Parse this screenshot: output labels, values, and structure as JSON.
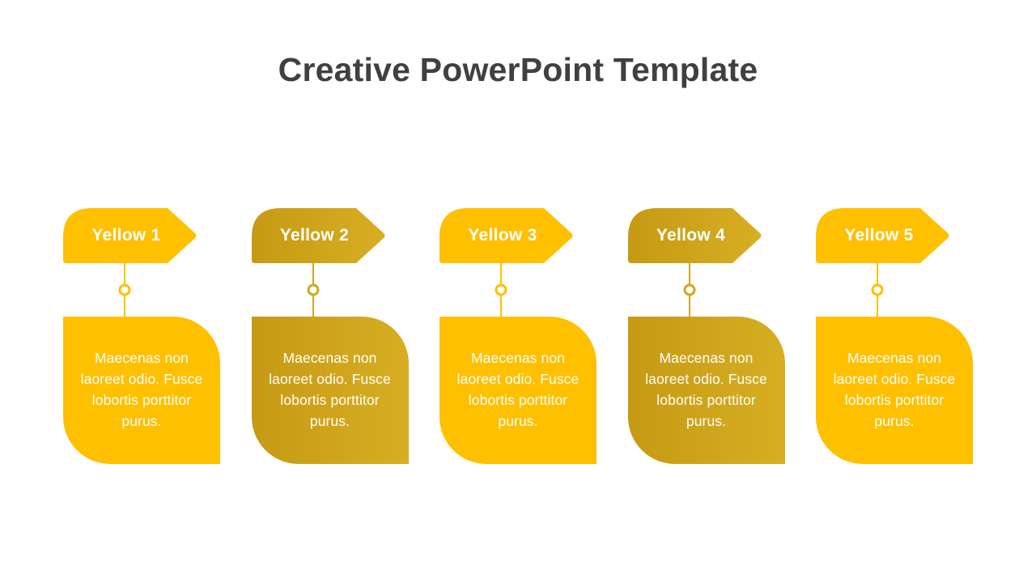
{
  "slide": {
    "title": "Creative PowerPoint Template",
    "background_color": "#ffffff",
    "title_color": "#404040"
  },
  "palette": {
    "bright_yellow": "#FFC000",
    "bright_yellow_dark": "#F5B800",
    "muted_gold": "#CCA21B",
    "muted_gold_dark": "#C69A14",
    "connector": "#FFC000",
    "connector_gold": "#D1A81E",
    "text_on_card": "#ffffff"
  },
  "cards": [
    {
      "id": "yellow-1",
      "label": "Yellow 1",
      "body": "Maecenas non laoreet odio. Fusce lobortis porttitor purus.",
      "banner_color": "#FFC000",
      "banner_color_end": "#FFC000",
      "body_color": "#FFC000",
      "body_color_end": "#FFC000",
      "connector_color": "#FFC000"
    },
    {
      "id": "yellow-2",
      "label": "Yellow 2",
      "body": "Maecenas non laoreet odio. Fusce lobortis porttitor purus.",
      "banner_color": "#C69A14",
      "banner_color_end": "#D7AE22",
      "body_color": "#C69A14",
      "body_color_end": "#D7AE22",
      "connector_color": "#D1A81E"
    },
    {
      "id": "yellow-3",
      "label": "Yellow 3",
      "body": "Maecenas non laoreet odio. Fusce lobortis porttitor purus.",
      "banner_color": "#FFC000",
      "banner_color_end": "#FFC000",
      "body_color": "#FFC000",
      "body_color_end": "#FFC000",
      "connector_color": "#FFC000"
    },
    {
      "id": "yellow-4",
      "label": "Yellow 4",
      "body": "Maecenas non laoreet odio. Fusce lobortis porttitor purus.",
      "banner_color": "#C69A14",
      "banner_color_end": "#D7AE22",
      "body_color": "#C69A14",
      "body_color_end": "#D7AE22",
      "connector_color": "#D1A81E"
    },
    {
      "id": "yellow-5",
      "label": "Yellow 5",
      "body": "Maecenas non laoreet odio. Fusce lobortis porttitor purus.",
      "banner_color": "#FFC000",
      "banner_color_end": "#FFC000",
      "body_color": "#FFC000",
      "body_color_end": "#FFC000",
      "connector_color": "#FFC000"
    }
  ]
}
